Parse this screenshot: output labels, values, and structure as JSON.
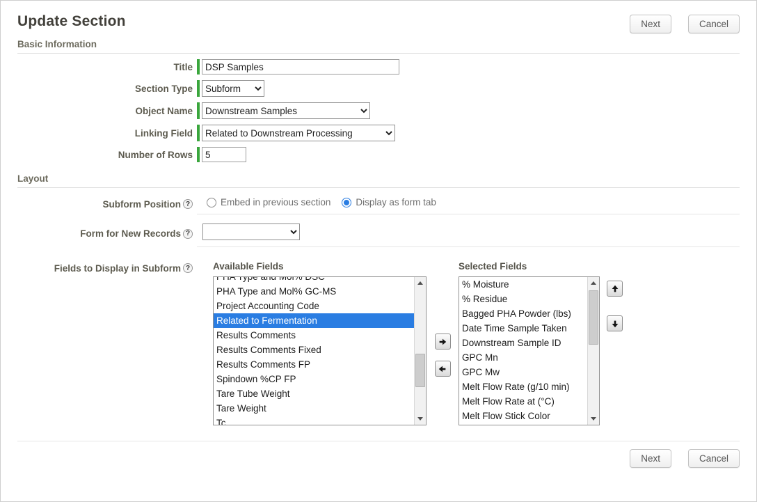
{
  "page": {
    "title": "Update Section"
  },
  "buttons": {
    "next": "Next",
    "cancel": "Cancel"
  },
  "icons": {
    "help": "?"
  },
  "sections": {
    "basic_information": "Basic Information",
    "layout": "Layout"
  },
  "form": {
    "title": {
      "label": "Title",
      "value": "DSP Samples"
    },
    "section_type": {
      "label": "Section Type",
      "value": "Subform"
    },
    "object_name": {
      "label": "Object Name",
      "value": "Downstream Samples"
    },
    "linking_field": {
      "label": "Linking Field",
      "value": "Related to Downstream Processing"
    },
    "number_of_rows": {
      "label": "Number of Rows",
      "value": "5"
    },
    "subform_position": {
      "label": "Subform Position",
      "options": [
        {
          "label": "Embed in previous section",
          "selected": false
        },
        {
          "label": "Display as form tab",
          "selected": true
        }
      ]
    },
    "form_for_new_records": {
      "label": "Form for New Records",
      "value": ""
    },
    "fields_to_display": {
      "label": "Fields to Display in Subform"
    }
  },
  "dual_list": {
    "available": {
      "label": "Available Fields",
      "items": [
        {
          "label": "PHA Type and Mol% DSC"
        },
        {
          "label": "PHA Type and Mol% GC-MS"
        },
        {
          "label": "Project Accounting Code"
        },
        {
          "label": "Related to Fermentation",
          "selected": true
        },
        {
          "label": "Results Comments"
        },
        {
          "label": "Results Comments Fixed"
        },
        {
          "label": "Results Comments FP"
        },
        {
          "label": "Spindown %CP FP"
        },
        {
          "label": "Tare Tube Weight"
        },
        {
          "label": "Tare Weight"
        },
        {
          "label": "Tc"
        }
      ]
    },
    "selected": {
      "label": "Selected Fields",
      "items": [
        {
          "label": "% Moisture"
        },
        {
          "label": "% Residue"
        },
        {
          "label": "Bagged PHA Powder (lbs)"
        },
        {
          "label": "Date Time Sample Taken"
        },
        {
          "label": "Downstream Sample ID"
        },
        {
          "label": "GPC Mn"
        },
        {
          "label": "GPC Mw"
        },
        {
          "label": "Melt Flow Rate (g/10 min)"
        },
        {
          "label": "Melt Flow Rate at (°C)"
        },
        {
          "label": "Melt Flow Stick Color"
        }
      ]
    }
  },
  "colors": {
    "selection_blue": "#2a7de2",
    "required_green": "#3aa63d"
  }
}
